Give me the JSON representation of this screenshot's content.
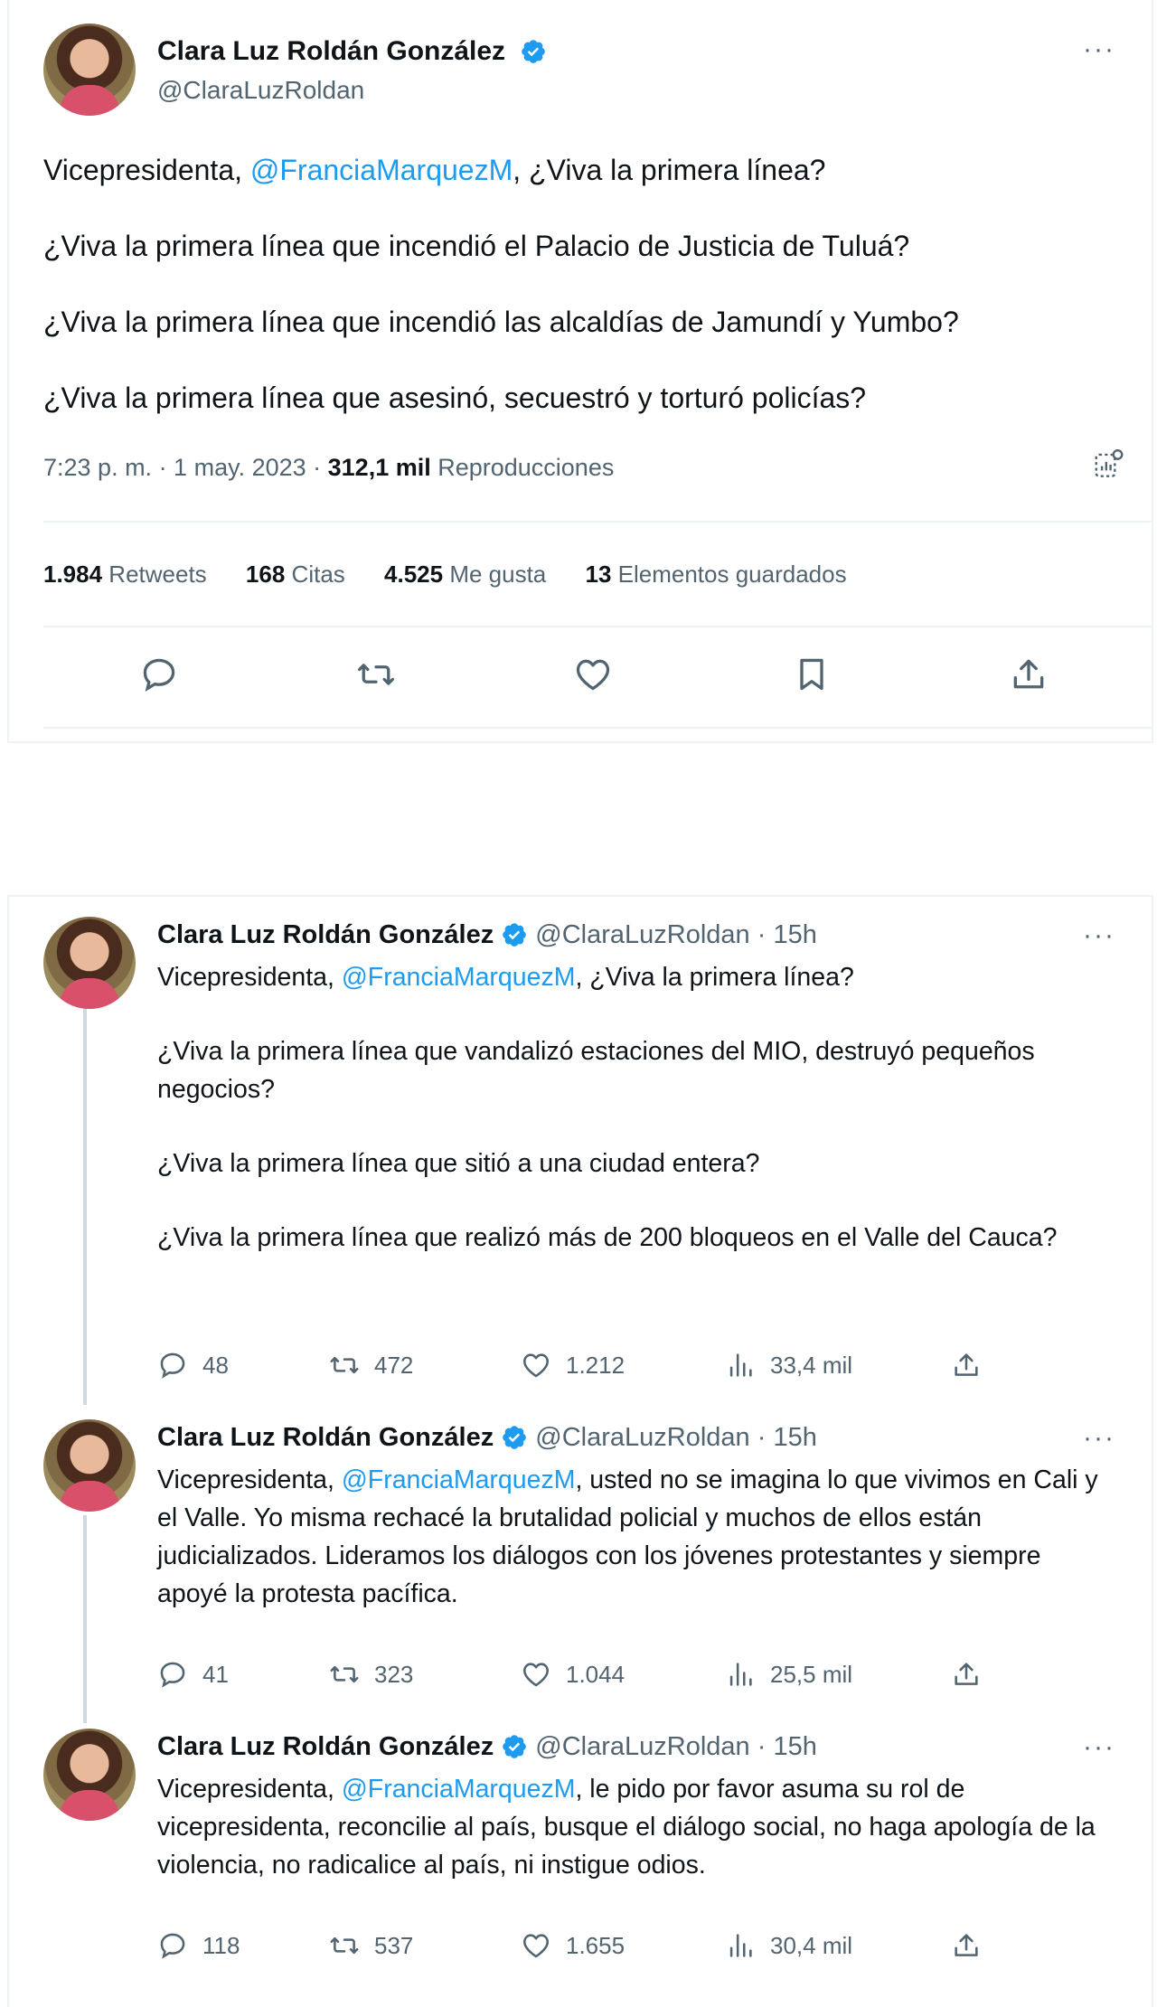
{
  "main_tweet": {
    "author_name": "Clara Luz Roldán González",
    "author_handle": "@ClaraLuzRoldan",
    "mention": "@FranciaMarquezM",
    "line1_prefix": "Vicepresidenta, ",
    "line1_suffix": ", ¿Viva la primera línea?",
    "line2": "¿Viva la primera línea que incendió el Palacio de Justicia de Tuluá?",
    "line3": "¿Viva la primera línea que incendió las alcaldías de Jamundí y Yumbo?",
    "line4": "¿Viva la primera línea que asesinó, secuestró y torturó policías?",
    "timestamp": "7:23 p. m. · 1 may. 2023 · ",
    "views_count": "312,1 mil",
    "views_label": " Reproducciones",
    "stats": {
      "retweets_count": "1.984",
      "retweets_label": " Retweets",
      "quotes_count": "168",
      "quotes_label": " Citas",
      "likes_count": "4.525",
      "likes_label": " Me gusta",
      "bookmarks_count": "13",
      "bookmarks_label": " Elementos guardados"
    }
  },
  "thread": {
    "author_name": "Clara Luz Roldán González",
    "author_handle": "@ClaraLuzRoldan",
    "time": " · 15h",
    "mention": "@FranciaMarquezM",
    "tweets": [
      {
        "prefix": "Vicepresidenta, ",
        "suffix": ", ¿Viva la primera línea?",
        "p2": "¿Viva la primera línea que vandalizó estaciones del MIO, destruyó pequeños negocios?",
        "p3": "¿Viva la primera línea que sitió a una ciudad entera?",
        "p4": "¿Viva la primera línea que realizó más de 200 bloqueos en el Valle del Cauca?",
        "replies": "48",
        "retweets": "472",
        "likes": "1.212",
        "views": "33,4 mil"
      },
      {
        "prefix": "Vicepresidenta, ",
        "suffix": ", usted no se imagina lo que vivimos en Cali y el Valle. Yo misma rechacé la brutalidad policial y muchos de ellos están judicializados. Lideramos los diálogos con los jóvenes protestantes y siempre apoyé la protesta pacífica.",
        "replies": "41",
        "retweets": "323",
        "likes": "1.044",
        "views": "25,5 mil"
      },
      {
        "prefix": "Vicepresidenta, ",
        "suffix": ", le pido por favor asuma su rol de vicepresidenta, reconcilie al país, busque el diálogo social, no haga apología de la violencia, no radicalice al país, ni instigue odios.",
        "replies": "118",
        "retweets": "537",
        "likes": "1.655",
        "views": "30,4 mil"
      }
    ]
  },
  "more_icon": "···",
  "colors": {
    "accent": "#1d9bf0",
    "muted": "#536471",
    "text": "#0f1419",
    "border": "#eff3f4"
  }
}
